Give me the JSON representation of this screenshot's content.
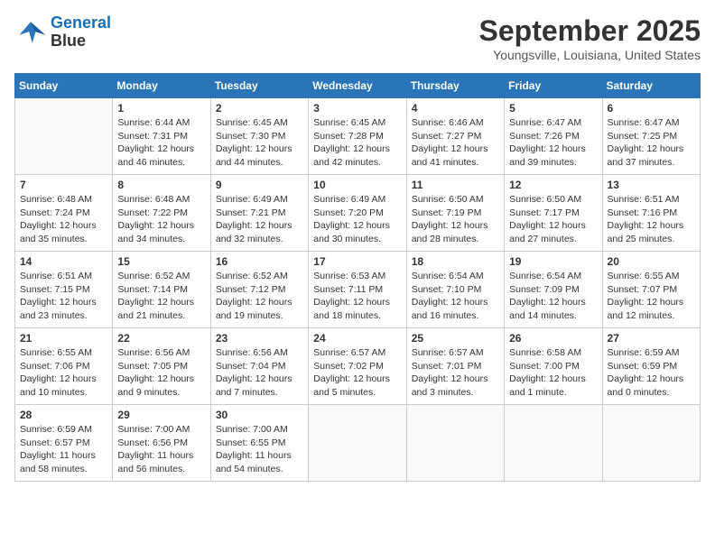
{
  "header": {
    "logo_line1": "General",
    "logo_line2": "Blue",
    "month": "September 2025",
    "location": "Youngsville, Louisiana, United States"
  },
  "days_of_week": [
    "Sunday",
    "Monday",
    "Tuesday",
    "Wednesday",
    "Thursday",
    "Friday",
    "Saturday"
  ],
  "weeks": [
    [
      {
        "num": "",
        "sunrise": "",
        "sunset": "",
        "daylight": ""
      },
      {
        "num": "1",
        "sunrise": "Sunrise: 6:44 AM",
        "sunset": "Sunset: 7:31 PM",
        "daylight": "Daylight: 12 hours and 46 minutes."
      },
      {
        "num": "2",
        "sunrise": "Sunrise: 6:45 AM",
        "sunset": "Sunset: 7:30 PM",
        "daylight": "Daylight: 12 hours and 44 minutes."
      },
      {
        "num": "3",
        "sunrise": "Sunrise: 6:45 AM",
        "sunset": "Sunset: 7:28 PM",
        "daylight": "Daylight: 12 hours and 42 minutes."
      },
      {
        "num": "4",
        "sunrise": "Sunrise: 6:46 AM",
        "sunset": "Sunset: 7:27 PM",
        "daylight": "Daylight: 12 hours and 41 minutes."
      },
      {
        "num": "5",
        "sunrise": "Sunrise: 6:47 AM",
        "sunset": "Sunset: 7:26 PM",
        "daylight": "Daylight: 12 hours and 39 minutes."
      },
      {
        "num": "6",
        "sunrise": "Sunrise: 6:47 AM",
        "sunset": "Sunset: 7:25 PM",
        "daylight": "Daylight: 12 hours and 37 minutes."
      }
    ],
    [
      {
        "num": "7",
        "sunrise": "Sunrise: 6:48 AM",
        "sunset": "Sunset: 7:24 PM",
        "daylight": "Daylight: 12 hours and 35 minutes."
      },
      {
        "num": "8",
        "sunrise": "Sunrise: 6:48 AM",
        "sunset": "Sunset: 7:22 PM",
        "daylight": "Daylight: 12 hours and 34 minutes."
      },
      {
        "num": "9",
        "sunrise": "Sunrise: 6:49 AM",
        "sunset": "Sunset: 7:21 PM",
        "daylight": "Daylight: 12 hours and 32 minutes."
      },
      {
        "num": "10",
        "sunrise": "Sunrise: 6:49 AM",
        "sunset": "Sunset: 7:20 PM",
        "daylight": "Daylight: 12 hours and 30 minutes."
      },
      {
        "num": "11",
        "sunrise": "Sunrise: 6:50 AM",
        "sunset": "Sunset: 7:19 PM",
        "daylight": "Daylight: 12 hours and 28 minutes."
      },
      {
        "num": "12",
        "sunrise": "Sunrise: 6:50 AM",
        "sunset": "Sunset: 7:17 PM",
        "daylight": "Daylight: 12 hours and 27 minutes."
      },
      {
        "num": "13",
        "sunrise": "Sunrise: 6:51 AM",
        "sunset": "Sunset: 7:16 PM",
        "daylight": "Daylight: 12 hours and 25 minutes."
      }
    ],
    [
      {
        "num": "14",
        "sunrise": "Sunrise: 6:51 AM",
        "sunset": "Sunset: 7:15 PM",
        "daylight": "Daylight: 12 hours and 23 minutes."
      },
      {
        "num": "15",
        "sunrise": "Sunrise: 6:52 AM",
        "sunset": "Sunset: 7:14 PM",
        "daylight": "Daylight: 12 hours and 21 minutes."
      },
      {
        "num": "16",
        "sunrise": "Sunrise: 6:52 AM",
        "sunset": "Sunset: 7:12 PM",
        "daylight": "Daylight: 12 hours and 19 minutes."
      },
      {
        "num": "17",
        "sunrise": "Sunrise: 6:53 AM",
        "sunset": "Sunset: 7:11 PM",
        "daylight": "Daylight: 12 hours and 18 minutes."
      },
      {
        "num": "18",
        "sunrise": "Sunrise: 6:54 AM",
        "sunset": "Sunset: 7:10 PM",
        "daylight": "Daylight: 12 hours and 16 minutes."
      },
      {
        "num": "19",
        "sunrise": "Sunrise: 6:54 AM",
        "sunset": "Sunset: 7:09 PM",
        "daylight": "Daylight: 12 hours and 14 minutes."
      },
      {
        "num": "20",
        "sunrise": "Sunrise: 6:55 AM",
        "sunset": "Sunset: 7:07 PM",
        "daylight": "Daylight: 12 hours and 12 minutes."
      }
    ],
    [
      {
        "num": "21",
        "sunrise": "Sunrise: 6:55 AM",
        "sunset": "Sunset: 7:06 PM",
        "daylight": "Daylight: 12 hours and 10 minutes."
      },
      {
        "num": "22",
        "sunrise": "Sunrise: 6:56 AM",
        "sunset": "Sunset: 7:05 PM",
        "daylight": "Daylight: 12 hours and 9 minutes."
      },
      {
        "num": "23",
        "sunrise": "Sunrise: 6:56 AM",
        "sunset": "Sunset: 7:04 PM",
        "daylight": "Daylight: 12 hours and 7 minutes."
      },
      {
        "num": "24",
        "sunrise": "Sunrise: 6:57 AM",
        "sunset": "Sunset: 7:02 PM",
        "daylight": "Daylight: 12 hours and 5 minutes."
      },
      {
        "num": "25",
        "sunrise": "Sunrise: 6:57 AM",
        "sunset": "Sunset: 7:01 PM",
        "daylight": "Daylight: 12 hours and 3 minutes."
      },
      {
        "num": "26",
        "sunrise": "Sunrise: 6:58 AM",
        "sunset": "Sunset: 7:00 PM",
        "daylight": "Daylight: 12 hours and 1 minute."
      },
      {
        "num": "27",
        "sunrise": "Sunrise: 6:59 AM",
        "sunset": "Sunset: 6:59 PM",
        "daylight": "Daylight: 12 hours and 0 minutes."
      }
    ],
    [
      {
        "num": "28",
        "sunrise": "Sunrise: 6:59 AM",
        "sunset": "Sunset: 6:57 PM",
        "daylight": "Daylight: 11 hours and 58 minutes."
      },
      {
        "num": "29",
        "sunrise": "Sunrise: 7:00 AM",
        "sunset": "Sunset: 6:56 PM",
        "daylight": "Daylight: 11 hours and 56 minutes."
      },
      {
        "num": "30",
        "sunrise": "Sunrise: 7:00 AM",
        "sunset": "Sunset: 6:55 PM",
        "daylight": "Daylight: 11 hours and 54 minutes."
      },
      {
        "num": "",
        "sunrise": "",
        "sunset": "",
        "daylight": ""
      },
      {
        "num": "",
        "sunrise": "",
        "sunset": "",
        "daylight": ""
      },
      {
        "num": "",
        "sunrise": "",
        "sunset": "",
        "daylight": ""
      },
      {
        "num": "",
        "sunrise": "",
        "sunset": "",
        "daylight": ""
      }
    ]
  ]
}
